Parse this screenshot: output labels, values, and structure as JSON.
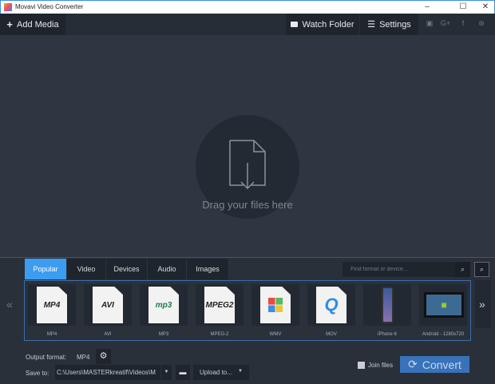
{
  "window": {
    "title": "Movavi Video Converter",
    "controls": [
      "–",
      "☐",
      "✕"
    ]
  },
  "toolbar": {
    "add_media": "Add Media",
    "watch_folder": "Watch Folder",
    "settings": "Settings",
    "social": [
      "youtube-icon",
      "google-plus-icon",
      "facebook-icon",
      "vk-icon"
    ]
  },
  "drop": {
    "text": "Drag your files here"
  },
  "tabs": [
    "Popular",
    "Video",
    "Devices",
    "Audio",
    "Images"
  ],
  "active_tab": "Popular",
  "search": {
    "placeholder": "Find format or device..."
  },
  "formats": [
    {
      "label": "MP4",
      "badge": "MP4",
      "color": "#222"
    },
    {
      "label": "AVI",
      "badge": "AVI",
      "color": "#222"
    },
    {
      "label": "MP3",
      "badge": "mp3",
      "color": "#1e7a4a"
    },
    {
      "label": "MPEG-2",
      "badge": "MPEG2",
      "color": "#222"
    },
    {
      "label": "WMV",
      "badge": "",
      "color": "#222"
    },
    {
      "label": "MOV",
      "badge": "Q",
      "color": "#2e8be6"
    },
    {
      "label": "iPhone 6",
      "badge": "",
      "color": "#222"
    },
    {
      "label": "Android - 1280x720",
      "badge": "",
      "color": "#222"
    }
  ],
  "bottom": {
    "output_label": "Output format:",
    "output_value": "MP4",
    "save_label": "Save to:",
    "save_path": "C:\\Users\\MASTERkreatif\\Videos\\M",
    "upload": "Upload to...",
    "join": "Join files",
    "convert": "Convert"
  },
  "colors": {
    "accent": "#3b9cf0",
    "convert": "#3872b8"
  }
}
